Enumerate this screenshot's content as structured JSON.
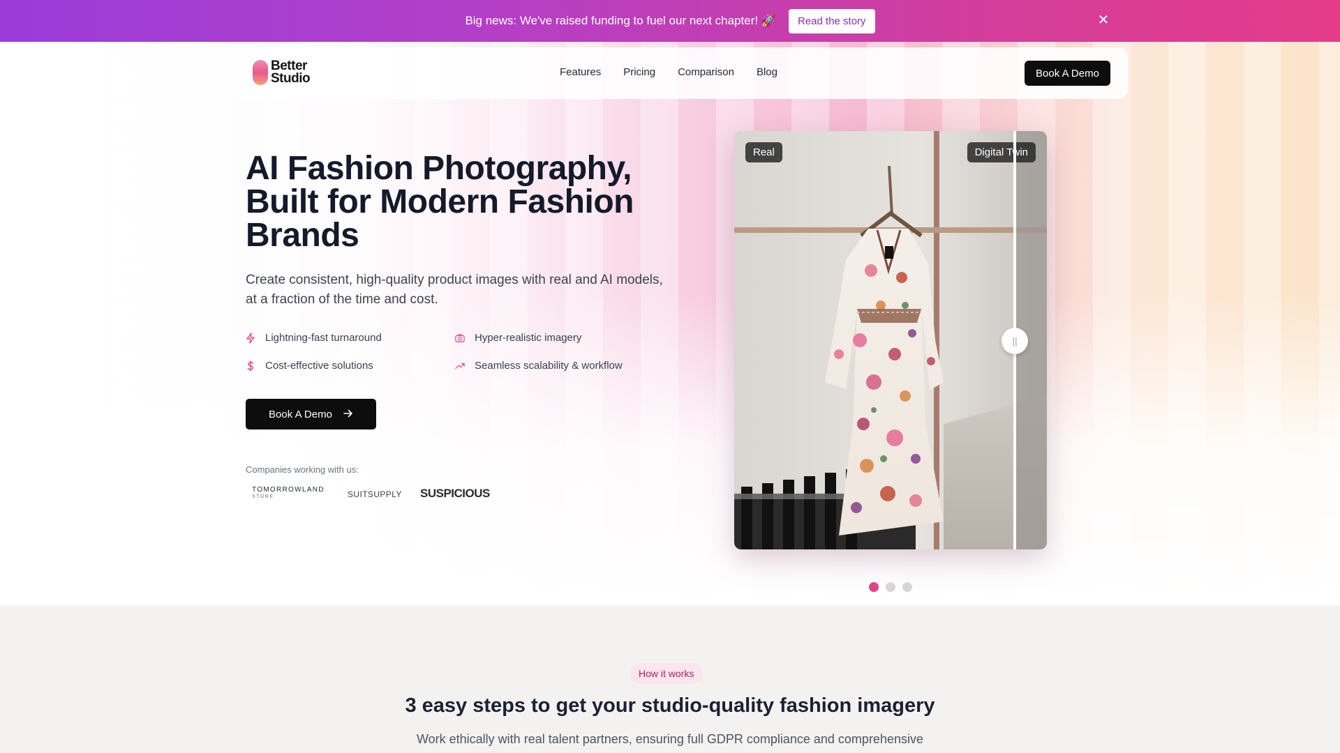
{
  "announcement": {
    "message": "Big news: We've raised funding to fuel our next chapter! 🚀",
    "button_label": "Read the story",
    "close_icon": "close-icon"
  },
  "nav": {
    "logo_line1": "Better",
    "logo_line2": "Studio",
    "links": [
      "Features",
      "Pricing",
      "Comparison",
      "Blog"
    ],
    "cta_label": "Book A Demo"
  },
  "hero": {
    "headline": "AI Fashion Photography, Built for Modern Fashion Brands",
    "subhead": "Create consistent, high-quality product images with real and AI models, at a fraction of the time and cost.",
    "features": [
      {
        "label": "Lightning-fast turnaround",
        "icon": "lightning-icon"
      },
      {
        "label": "Hyper-realistic imagery",
        "icon": "camera-icon"
      },
      {
        "label": "Cost-effective solutions",
        "icon": "dollar-icon"
      },
      {
        "label": "Seamless scalability & workflow",
        "icon": "trending-up-icon"
      }
    ],
    "cta_label": "Book A Demo",
    "companies_label": "Companies working with us:",
    "brands": {
      "tomorrowland": "TOMORROWLAND",
      "tomorrowland_sub": "STORE",
      "suitsupply": "SUITSUPPLY",
      "suspicious": "SUSPICIOUS"
    }
  },
  "comparison": {
    "left_tag": "Real",
    "right_tag": "Digital Twin",
    "slider_position": 0.9,
    "slides_total": 3,
    "active_slide": 1
  },
  "how_it_works": {
    "badge": "How it works",
    "title": "3 easy steps to get your studio-quality fashion imagery",
    "subtitle": "Work ethically with real talent partners, ensuring full GDPR compliance and comprehensive"
  },
  "colors": {
    "accent": "#e0438a",
    "banner_start": "#9b3cd9",
    "banner_end": "#e53c8a",
    "dark": "#0d0d0d"
  }
}
